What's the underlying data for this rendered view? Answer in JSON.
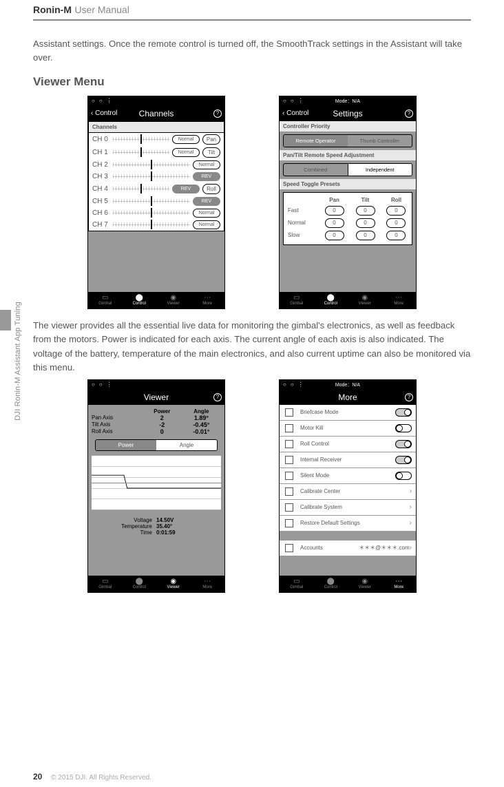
{
  "header": {
    "product": "Ronin-M",
    "suffix": "User Manual"
  },
  "intro": "Assistant settings. Once the remote control is turned off, the SmoothTrack settings in the Assistant will take over.",
  "heading1": "Viewer Menu",
  "side_text": "DJI Ronin-M Assistant App Tuning",
  "para2": "The viewer provides all the essential live data for monitoring the gimbal's electronics, as well as feedback from the motors. Power is indicated for each axis. The current angle of each axis is also indicated. The voltage of the battery, temperature of the main electronics, and also current uptime can also be monitored via this menu.",
  "footer": {
    "page": "20",
    "copyright": "© 2015 DJI. All Rights Reserved."
  },
  "nav": {
    "gimbal": "Gimbal",
    "control": "Control",
    "viewer": "Viewer",
    "more": "More"
  },
  "mode_label": "Mode：N/A",
  "screen_channels": {
    "back": "Control",
    "title": "Channels",
    "section": "Channels",
    "rows": [
      {
        "ch": "CH 0",
        "mode": "Normal",
        "axis": "Pan"
      },
      {
        "ch": "CH 1",
        "mode": "Normal",
        "axis": "Tilt"
      },
      {
        "ch": "CH 2",
        "mode": "Normal",
        "axis": ""
      },
      {
        "ch": "CH 3",
        "mode": "REV",
        "axis": ""
      },
      {
        "ch": "CH 4",
        "mode": "REV",
        "axis": "Roll"
      },
      {
        "ch": "CH 5",
        "mode": "REV",
        "axis": ""
      },
      {
        "ch": "CH 6",
        "mode": "Normal",
        "axis": ""
      },
      {
        "ch": "CH 7",
        "mode": "Normal",
        "axis": ""
      }
    ]
  },
  "screen_settings": {
    "back": "Control",
    "title": "Settings",
    "sect1": "Controller Priority",
    "opt1a": "Remote Operator",
    "opt1b": "Thumb Controller",
    "sect2": "Pan/Tilt Remote Speed Adjustment",
    "opt2a": "Combined",
    "opt2b": "Independent",
    "sect3": "Speed Toggle Presets",
    "cols": {
      "c1": "Pan",
      "c2": "Tilt",
      "c3": "Roll"
    },
    "rows": {
      "r1": "Fast",
      "r2": "Normal",
      "r3": "Slow"
    },
    "vals": {
      "fast": [
        "0",
        "0",
        "0"
      ],
      "normal": [
        "0",
        "0",
        "0"
      ],
      "slow": [
        "0",
        "0",
        "0"
      ]
    }
  },
  "screen_viewer": {
    "title": "Viewer",
    "hdr_power": "Power",
    "hdr_angle": "Angle",
    "rows": [
      {
        "label": "Pan Axis",
        "power": "2",
        "angle": "1.89°"
      },
      {
        "label": "Tilt Axis",
        "power": "-2",
        "angle": "-0.45°"
      },
      {
        "label": "Roll Axis",
        "power": "0",
        "angle": "-0.01°"
      }
    ],
    "seg": {
      "a": "Power",
      "b": "Angle"
    },
    "sys": [
      {
        "k": "Voltage",
        "v": "14.50V"
      },
      {
        "k": "Temperature",
        "v": "35.40°"
      },
      {
        "k": "Time",
        "v": "0:01:59"
      }
    ]
  },
  "screen_more": {
    "title": "More",
    "items": [
      {
        "label": "Briefcase Mode",
        "type": "toggle",
        "on": true
      },
      {
        "label": "Motor Kill",
        "type": "toggle",
        "on": false
      },
      {
        "label": "Roll Control",
        "type": "toggle",
        "on": true
      },
      {
        "label": "Internal Receiver",
        "type": "toggle",
        "on": true
      },
      {
        "label": "Silent Mode",
        "type": "toggle",
        "on": false
      },
      {
        "label": "Calibrate Center",
        "type": "chevron"
      },
      {
        "label": "Calibrate System",
        "type": "chevron"
      },
      {
        "label": "Restore Default Settings",
        "type": "chevron"
      }
    ],
    "account_label": "Accounts",
    "account_value": "＊＊＊@＊＊＊.com"
  }
}
